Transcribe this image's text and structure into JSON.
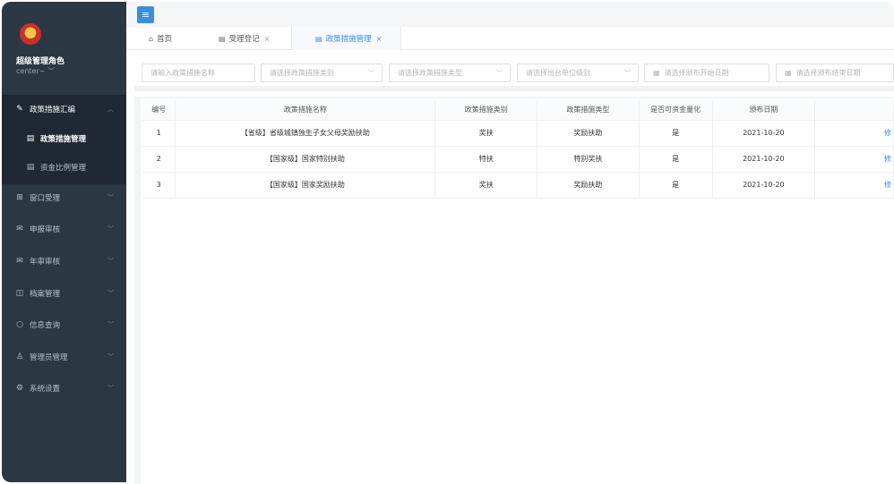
{
  "sidebar": {
    "role_name": "超级管理角色",
    "user_name": "center~ ﹀",
    "items": [
      {
        "label": "政策措施汇编",
        "icon": "edit-icon",
        "chevron": "︿"
      },
      {
        "label": "政策措施管理",
        "icon": "document-icon"
      },
      {
        "label": "资金比例管理",
        "icon": "document-icon"
      },
      {
        "label": "窗口受理",
        "icon": "file-add-icon",
        "chevron": "﹀"
      },
      {
        "label": "申报审核",
        "icon": "mail-check-icon",
        "chevron": "﹀"
      },
      {
        "label": "年审审核",
        "icon": "mail-check-icon",
        "chevron": "﹀"
      },
      {
        "label": "档案管理",
        "icon": "book-icon",
        "chevron": "﹀"
      },
      {
        "label": "信息查询",
        "icon": "search-icon",
        "chevron": "﹀"
      },
      {
        "label": "管理员管理",
        "icon": "user-icon",
        "chevron": "﹀"
      },
      {
        "label": "系统设置",
        "icon": "gear-icon",
        "chevron": "﹀"
      }
    ]
  },
  "topbar": {
    "menu_icon": "≡"
  },
  "tabs": [
    {
      "label": "首页",
      "icon": "home-icon",
      "close": ""
    },
    {
      "label": "受理登记",
      "icon": "document-icon",
      "close": "×"
    },
    {
      "label": "政策措施管理",
      "icon": "document-icon",
      "close": "×"
    }
  ],
  "filters": {
    "name_placeholder": "请输入政策措施名称",
    "category_placeholder": "请选择政策措施类别",
    "type_placeholder": "请选择政策措施类型",
    "level_placeholder": "请选择出台单位级别",
    "start_date_placeholder": "请选择颁布开始日期",
    "end_date_placeholder": "请选择颁布结束日期"
  },
  "table": {
    "headers": [
      "编号",
      "政策措施名称",
      "政策措施类别",
      "政策措施类型",
      "是否可资金量化",
      "颁布日期",
      ""
    ],
    "rows": [
      {
        "id": "1",
        "name": "【省级】省级城镇独生子女父母奖励扶助",
        "category": "奖扶",
        "type": "奖励扶助",
        "quantifiable": "是",
        "date": "2021-10-20",
        "op": "修"
      },
      {
        "id": "2",
        "name": "【国家级】国家特别扶助",
        "category": "特扶",
        "type": "特别奖扶",
        "quantifiable": "是",
        "date": "2021-10-20",
        "op": "修"
      },
      {
        "id": "3",
        "name": "【国家级】国家奖励扶助",
        "category": "奖扶",
        "type": "奖励扶助",
        "quantifiable": "是",
        "date": "2021-10-20",
        "op": "修"
      }
    ]
  },
  "colors": {
    "accent": "#3c8dde",
    "sidebar_bg": "#2c3744",
    "sidebar_active_bg": "#1f2833"
  }
}
